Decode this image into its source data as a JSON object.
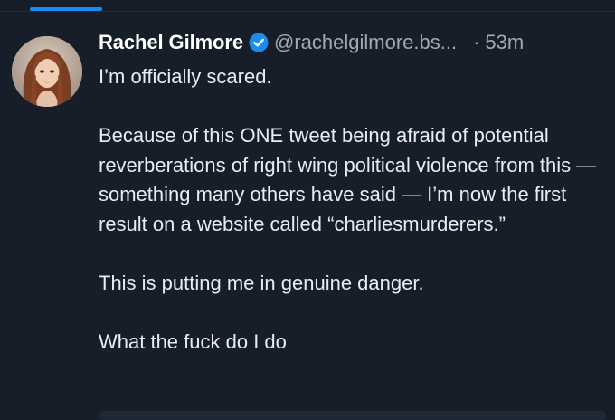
{
  "post": {
    "author": {
      "display_name": "Rachel Gilmore",
      "handle": "@rachelgilmore.bs...",
      "verified": true,
      "verified_icon": "verified-check-icon",
      "verified_color": "#1c8cf0"
    },
    "separator": "·",
    "timestamp": "53m",
    "paragraphs": [
      "I’m officially scared.",
      "Because of this ONE tweet being afraid of potential reverberations of right wing political violence from this — something many others have said — I’m now the first result on a website called “charliesmurderers.”",
      "This is putting me in genuine danger.",
      "What the fuck do I do"
    ]
  },
  "theme": {
    "background": "#161e29",
    "accent": "#1c8cf0",
    "text": "#e8edf2",
    "muted": "#a0aab6"
  }
}
